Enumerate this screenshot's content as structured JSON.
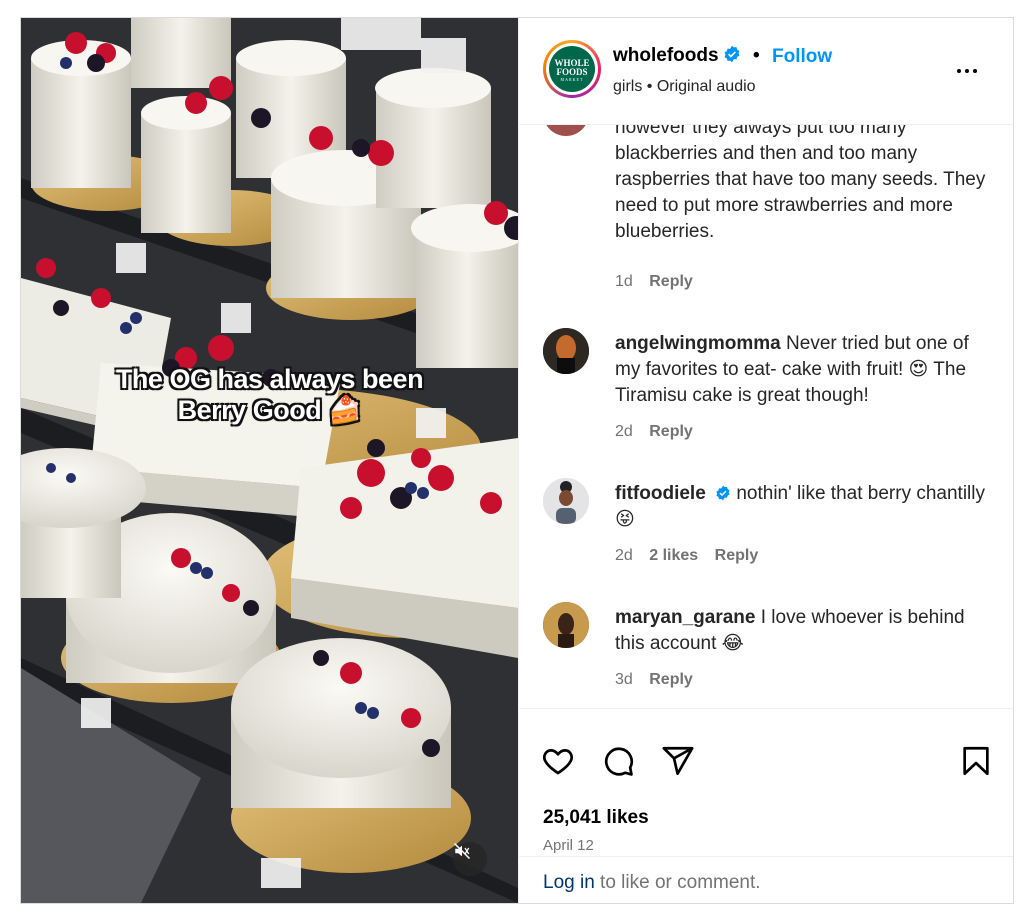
{
  "post": {
    "caption_line1": "The OG has always been",
    "caption_line2": "Berry Good",
    "caption_emoji": "🍰"
  },
  "header": {
    "username": "wholefoods",
    "separator": "•",
    "follow_label": "Follow",
    "audio_line": "girls • Original audio",
    "logo_text": "WHOLE FOODS",
    "logo_sub": "MARKET"
  },
  "comments": [
    {
      "text_partial": "however they always put too many blackberries and then and too many raspberries that have too many seeds. They need to put more strawberries and more blueberries.",
      "time": "1d",
      "reply": "Reply"
    },
    {
      "username": "angelwingmomma",
      "text": "Never tried but one of my favorites to eat- cake with fruit! 😍 The Tiramisu cake is great though!",
      "time": "2d",
      "reply": "Reply"
    },
    {
      "username": "fitfoodiele",
      "text": "nothin' like that berry chantilly 😝",
      "time": "2d",
      "likes": "2 likes",
      "reply": "Reply"
    },
    {
      "username": "maryan_garane",
      "text": "I love whoever is behind this account 😂",
      "time": "3d",
      "reply": "Reply"
    }
  ],
  "stats": {
    "likes": "25,041 likes",
    "date": "April 12"
  },
  "footer": {
    "login_link": "Log in",
    "login_rest": " to like or comment."
  },
  "colors": {
    "accent": "#0095f6",
    "verified": "#0095f6",
    "muted_text": "#737373",
    "brand_green": "#00674b"
  },
  "icons": [
    "heart-icon",
    "comment-icon",
    "share-icon",
    "bookmark-icon",
    "more-icon",
    "verified-icon",
    "mute-icon"
  ]
}
